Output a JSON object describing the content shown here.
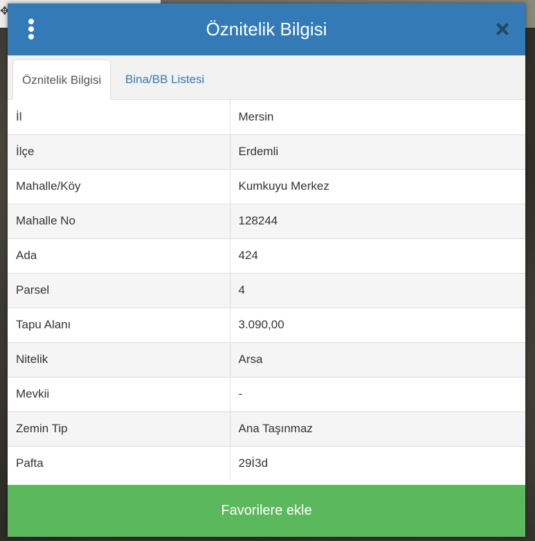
{
  "header": {
    "title": "Öznitelik Bilgisi",
    "menu_icon": "kebab-menu-icon",
    "close_icon": "close-icon"
  },
  "tabs": [
    {
      "label": "Öznitelik Bilgisi",
      "active": true
    },
    {
      "label": "Bina/BB Listesi",
      "active": false
    }
  ],
  "attributes": [
    {
      "key": "İl",
      "value": "Mersin"
    },
    {
      "key": "İlçe",
      "value": "Erdemli"
    },
    {
      "key": "Mahalle/Köy",
      "value": "Kumkuyu Merkez"
    },
    {
      "key": "Mahalle No",
      "value": "128244"
    },
    {
      "key": "Ada",
      "value": "424"
    },
    {
      "key": "Parsel",
      "value": "4"
    },
    {
      "key": "Tapu Alanı",
      "value": "3.090,00"
    },
    {
      "key": "Nitelik",
      "value": "Arsa"
    },
    {
      "key": "Mevkii",
      "value": "-"
    },
    {
      "key": "Zemin Tip",
      "value": "Ana Taşınmaz"
    },
    {
      "key": "Pafta",
      "value": "29İ3d"
    }
  ],
  "footer": {
    "favorite_label": "Favorilere ekle"
  },
  "colors": {
    "header_bg": "#337ab7",
    "favorite_bg": "#5cb85c",
    "tab_link": "#337ab7"
  }
}
